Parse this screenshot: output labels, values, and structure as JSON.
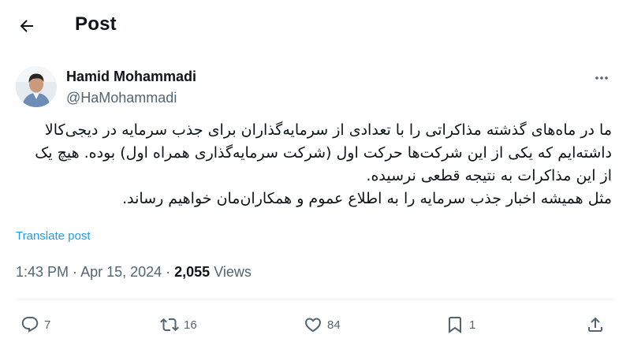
{
  "header": {
    "title": "Post",
    "back_icon": "arrow-left-icon"
  },
  "post": {
    "author": {
      "name": "Hamid Mohammadi",
      "handle": "@HaMohammadi"
    },
    "text_lines": [
      "ما در ماه‌های گذشته مذاکراتی را با تعدادی از سرمایه‌گذاران برای جذب سرمایه در دیجی‌کالا داشته‌ایم که یکی از این شرکت‌ها حرکت اول (شرکت سرمایه‌گذاری همراه اول) بوده. هیچ یک از این مذاکرات به نتیجه قطعی نرسیده.",
      "مثل همیشه اخبار جذب سرمایه را به اطلاع عموم و همکاران‌مان خواهیم رساند."
    ],
    "translate_label": "Translate post",
    "time": "1:43 PM",
    "separator": " · ",
    "date": "Apr 15, 2024",
    "views_count": "2,055",
    "views_label": " Views"
  },
  "actions": {
    "replies": "7",
    "reposts": "16",
    "likes": "84",
    "bookmarks": "1"
  },
  "colors": {
    "text": "#0f1419",
    "secondary": "#536471",
    "link": "#1d9bf0",
    "divider": "#eff3f4"
  }
}
